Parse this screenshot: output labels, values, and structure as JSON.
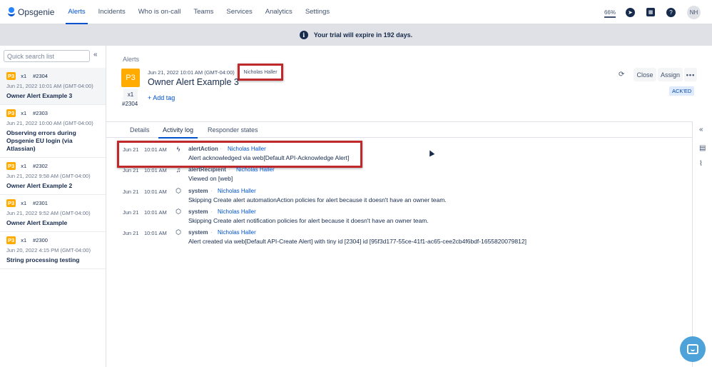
{
  "app": {
    "name": "Opsgenie"
  },
  "nav": {
    "items": [
      "Alerts",
      "Incidents",
      "Who is on-call",
      "Teams",
      "Services",
      "Analytics",
      "Settings"
    ],
    "zoom": "66%",
    "avatar": "NH"
  },
  "banner": {
    "text": "Your trial will expire in 192 days."
  },
  "sidebar": {
    "search_placeholder": "Quick search list",
    "alerts": [
      {
        "priority": "P3",
        "count": "x1",
        "id": "#2304",
        "date": "Jun 21, 2022 10:01 AM (GMT-04:00)",
        "title": "Owner Alert Example 3"
      },
      {
        "priority": "P3",
        "count": "x1",
        "id": "#2303",
        "date": "Jun 21, 2022 10:00 AM (GMT-04:00)",
        "title": "Observing errors during Opsgenie EU login (via Atlassian)"
      },
      {
        "priority": "P3",
        "count": "x1",
        "id": "#2302",
        "date": "Jun 21, 2022 9:58 AM (GMT-04:00)",
        "title": "Owner Alert Example 2"
      },
      {
        "priority": "P3",
        "count": "x1",
        "id": "#2301",
        "date": "Jun 21, 2022 9:52 AM (GMT-04:00)",
        "title": "Owner Alert Example"
      },
      {
        "priority": "P3",
        "count": "x1",
        "id": "#2300",
        "date": "Jun 20, 2022 4:15 PM (GMT-04:00)",
        "title": "String processing testing"
      }
    ]
  },
  "detail": {
    "breadcrumb": "Alerts",
    "priority": "P3",
    "count": "x1",
    "id": "#2304",
    "date": "Jun 21, 2022 10:01 AM (GMT-04:00)",
    "owner": "Nicholas Haller",
    "title": "Owner Alert Example 3",
    "add_tag": "+ Add tag",
    "close_label": "Close",
    "assign_label": "Assign",
    "more_label": "•••",
    "status": "ACK'ED",
    "tabs": [
      "Details",
      "Activity log",
      "Responder states"
    ]
  },
  "activity_log": [
    {
      "date": "Jun 21",
      "time": "10:01 AM",
      "icon": "bolt-icon",
      "type": "alertAction",
      "user": "Nicholas Haller",
      "message": "Alert acknowledged via web[Default API-Acknowledge Alert]"
    },
    {
      "date": "Jun 21",
      "time": "10:01 AM",
      "icon": "bell-icon",
      "type": "alertRecipient",
      "user": "Nicholas Haller",
      "message": "Viewed on [web]"
    },
    {
      "date": "Jun 21",
      "time": "10:01 AM",
      "icon": "cube-icon",
      "type": "system",
      "user": "Nicholas Haller",
      "message": "Skipping Create alert automationAction policies for alert because it doesn't have an owner team."
    },
    {
      "date": "Jun 21",
      "time": "10:01 AM",
      "icon": "cube-icon",
      "type": "system",
      "user": "Nicholas Haller",
      "message": "Skipping Create alert notification policies for alert because it doesn't have an owner team."
    },
    {
      "date": "Jun 21",
      "time": "10:01 AM",
      "icon": "cube-icon",
      "type": "system",
      "user": "Nicholas Haller",
      "message": "Alert created via web[Default API-Create Alert] with tiny id [2304] id [95f3d177-55ce-41f1-ac65-cee2cb4f6bdf-1655820079812]"
    }
  ]
}
